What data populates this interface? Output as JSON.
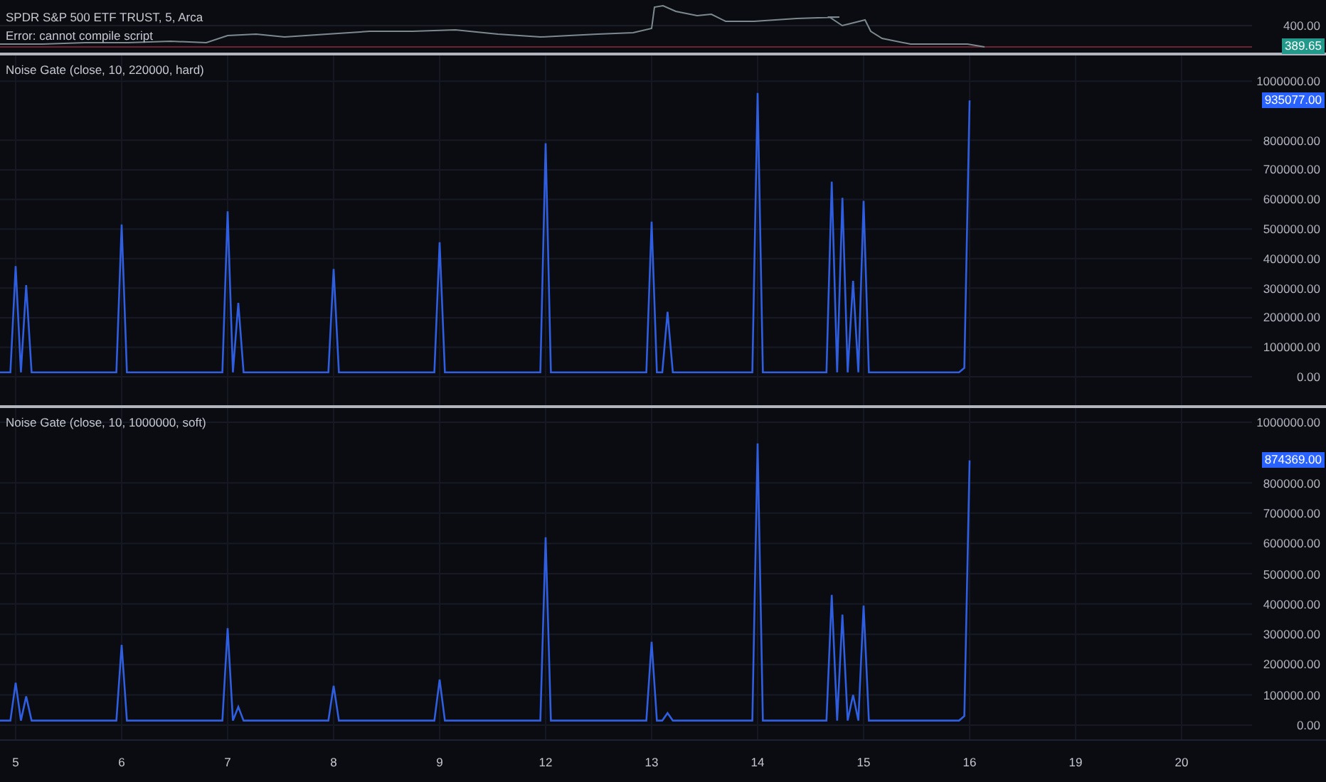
{
  "main_pane": {
    "symbol_title": "SPDR S&P 500 ETF TRUST, 5, Arca",
    "error_message": "Error: cannot compile script",
    "price_scale": [
      "400.00"
    ],
    "last_price": "389.65"
  },
  "panes": [
    {
      "last_value": "935077.00",
      "chart_data": {
        "type": "line",
        "title": "Noise Gate (close, 10, 220000, hard)",
        "categories": [
          null,
          null,
          null,
          null,
          null,
          null,
          null,
          null,
          null,
          null,
          null,
          null,
          null,
          null,
          null,
          null,
          null,
          null,
          null,
          null,
          null,
          null,
          null,
          null,
          null,
          null,
          null,
          null,
          null,
          null,
          null,
          null,
          null,
          null,
          null,
          null,
          null,
          null,
          null,
          null,
          null,
          null,
          null,
          null,
          null,
          null,
          null,
          null,
          null,
          null,
          null,
          null,
          null,
          null,
          null,
          null,
          null,
          null,
          null,
          null,
          null,
          null,
          null,
          null,
          null,
          null,
          null,
          null,
          null,
          null,
          null,
          null,
          null,
          null,
          null,
          null,
          null,
          null,
          null,
          null,
          null,
          null,
          null,
          null,
          null,
          null,
          null,
          null,
          null,
          null,
          null,
          null,
          null,
          null,
          null,
          null,
          null,
          null,
          null,
          null,
          null,
          null,
          null,
          null,
          null,
          null,
          null,
          null,
          null,
          null,
          null,
          null,
          null,
          null,
          null,
          null,
          null,
          null,
          null,
          null,
          null,
          null,
          null,
          null,
          null,
          null,
          null,
          null,
          null,
          null,
          null,
          null,
          null,
          null,
          null,
          null,
          null,
          null,
          null,
          null,
          null,
          null,
          null,
          null,
          null,
          null,
          null,
          null,
          null,
          null,
          null,
          null,
          null,
          null,
          null,
          null,
          null,
          null,
          null,
          null,
          null,
          null,
          null,
          null,
          null,
          null,
          null,
          null,
          null,
          null,
          null,
          null,
          null,
          null,
          null,
          null,
          null,
          null,
          null,
          null,
          null,
          null,
          null,
          null
        ],
        "series": [
          {
            "color": "#2f5fe0",
            "values": [
              15000,
              15000,
              15000,
              375000,
              15000,
              310000,
              15000,
              15000,
              15000,
              15000,
              15000,
              15000,
              15000,
              15000,
              15000,
              15000,
              15000,
              15000,
              15000,
              15000,
              15000,
              15000,
              15000,
              515000,
              15000,
              15000,
              15000,
              15000,
              15000,
              15000,
              15000,
              15000,
              15000,
              15000,
              15000,
              15000,
              15000,
              15000,
              15000,
              15000,
              15000,
              15000,
              15000,
              560000,
              15000,
              250000,
              15000,
              15000,
              15000,
              15000,
              15000,
              15000,
              15000,
              15000,
              15000,
              15000,
              15000,
              15000,
              15000,
              15000,
              15000,
              15000,
              15000,
              365000,
              15000,
              15000,
              15000,
              15000,
              15000,
              15000,
              15000,
              15000,
              15000,
              15000,
              15000,
              15000,
              15000,
              15000,
              15000,
              15000,
              15000,
              15000,
              15000,
              455000,
              15000,
              15000,
              15000,
              15000,
              15000,
              15000,
              15000,
              15000,
              15000,
              15000,
              15000,
              15000,
              15000,
              15000,
              15000,
              15000,
              15000,
              15000,
              15000,
              790000,
              15000,
              15000,
              15000,
              15000,
              15000,
              15000,
              15000,
              15000,
              15000,
              15000,
              15000,
              15000,
              15000,
              15000,
              15000,
              15000,
              15000,
              15000,
              15000,
              525000,
              15000,
              15000,
              220000,
              15000,
              15000,
              15000,
              15000,
              15000,
              15000,
              15000,
              15000,
              15000,
              15000,
              15000,
              15000,
              15000,
              15000,
              15000,
              15000,
              960000,
              15000,
              15000,
              15000,
              15000,
              15000,
              15000,
              15000,
              15000,
              15000,
              15000,
              15000,
              15000,
              15000,
              660000,
              15000,
              605000,
              15000,
              325000,
              15000,
              595000,
              15000,
              15000,
              15000,
              15000,
              15000,
              15000,
              15000,
              15000,
              15000,
              15000,
              15000,
              15000,
              15000,
              15000,
              15000,
              15000,
              15000,
              15000,
              30000,
              935000
            ]
          }
        ],
        "grid": true,
        "ylim": [
          -96000,
          1087000
        ],
        "yticks": [
          {
            "value": 0,
            "label": "0.00"
          },
          {
            "value": 100000,
            "label": "100000.00"
          },
          {
            "value": 200000,
            "label": "200000.00"
          },
          {
            "value": 300000,
            "label": "300000.00"
          },
          {
            "value": 400000,
            "label": "400000.00"
          },
          {
            "value": 500000,
            "label": "500000.00"
          },
          {
            "value": 600000,
            "label": "600000.00"
          },
          {
            "value": 700000,
            "label": "700000.00"
          },
          {
            "value": 800000,
            "label": "800000.00"
          },
          {
            "value": 1000000,
            "label": "1000000.00"
          }
        ]
      }
    },
    {
      "last_value": "874369.00",
      "chart_data": {
        "type": "line",
        "title": "Noise Gate (close, 10, 1000000, soft)",
        "categories": [
          null,
          null,
          null,
          null,
          null,
          null,
          null,
          null,
          null,
          null,
          null,
          null,
          null,
          null,
          null,
          null,
          null,
          null,
          null,
          null,
          null,
          null,
          null,
          null,
          null,
          null,
          null,
          null,
          null,
          null,
          null,
          null,
          null,
          null,
          null,
          null,
          null,
          null,
          null,
          null,
          null,
          null,
          null,
          null,
          null,
          null,
          null,
          null,
          null,
          null,
          null,
          null,
          null,
          null,
          null,
          null,
          null,
          null,
          null,
          null,
          null,
          null,
          null,
          null,
          null,
          null,
          null,
          null,
          null,
          null,
          null,
          null,
          null,
          null,
          null,
          null,
          null,
          null,
          null,
          null,
          null,
          null,
          null,
          null,
          null,
          null,
          null,
          null,
          null,
          null,
          null,
          null,
          null,
          null,
          null,
          null,
          null,
          null,
          null,
          null,
          null,
          null,
          null,
          null,
          null,
          null,
          null,
          null,
          null,
          null,
          null,
          null,
          null,
          null,
          null,
          null,
          null,
          null,
          null,
          null,
          null,
          null,
          null,
          null,
          null,
          null,
          null,
          null,
          null,
          null,
          null,
          null,
          null,
          null,
          null,
          null,
          null,
          null,
          null,
          null,
          null,
          null,
          null,
          null,
          null,
          null,
          null,
          null,
          null,
          null,
          null,
          null,
          null,
          null,
          null,
          null,
          null,
          null,
          null,
          null,
          null,
          null,
          null,
          null,
          null,
          null,
          null,
          null,
          null,
          null,
          null,
          null,
          null,
          null,
          null,
          null,
          null,
          null,
          null,
          null,
          null,
          null,
          null,
          null
        ],
        "series": [
          {
            "color": "#2f5fe0",
            "values": [
              15000,
              15000,
              15000,
              140000,
              15000,
              95000,
              15000,
              15000,
              15000,
              15000,
              15000,
              15000,
              15000,
              15000,
              15000,
              15000,
              15000,
              15000,
              15000,
              15000,
              15000,
              15000,
              15000,
              265000,
              15000,
              15000,
              15000,
              15000,
              15000,
              15000,
              15000,
              15000,
              15000,
              15000,
              15000,
              15000,
              15000,
              15000,
              15000,
              15000,
              15000,
              15000,
              15000,
              320000,
              15000,
              60000,
              15000,
              15000,
              15000,
              15000,
              15000,
              15000,
              15000,
              15000,
              15000,
              15000,
              15000,
              15000,
              15000,
              15000,
              15000,
              15000,
              15000,
              130000,
              15000,
              15000,
              15000,
              15000,
              15000,
              15000,
              15000,
              15000,
              15000,
              15000,
              15000,
              15000,
              15000,
              15000,
              15000,
              15000,
              15000,
              15000,
              15000,
              150000,
              15000,
              15000,
              15000,
              15000,
              15000,
              15000,
              15000,
              15000,
              15000,
              15000,
              15000,
              15000,
              15000,
              15000,
              15000,
              15000,
              15000,
              15000,
              15000,
              620000,
              15000,
              15000,
              15000,
              15000,
              15000,
              15000,
              15000,
              15000,
              15000,
              15000,
              15000,
              15000,
              15000,
              15000,
              15000,
              15000,
              15000,
              15000,
              15000,
              275000,
              15000,
              15000,
              40000,
              15000,
              15000,
              15000,
              15000,
              15000,
              15000,
              15000,
              15000,
              15000,
              15000,
              15000,
              15000,
              15000,
              15000,
              15000,
              15000,
              930000,
              15000,
              15000,
              15000,
              15000,
              15000,
              15000,
              15000,
              15000,
              15000,
              15000,
              15000,
              15000,
              15000,
              430000,
              15000,
              365000,
              15000,
              100000,
              15000,
              395000,
              15000,
              15000,
              15000,
              15000,
              15000,
              15000,
              15000,
              15000,
              15000,
              15000,
              15000,
              15000,
              15000,
              15000,
              15000,
              15000,
              15000,
              15000,
              30000,
              874000
            ]
          }
        ],
        "grid": true,
        "ylim": [
          -47000,
          1047000
        ],
        "yticks": [
          {
            "value": 0,
            "label": "0.00"
          },
          {
            "value": 100000,
            "label": "100000.00"
          },
          {
            "value": 200000,
            "label": "200000.00"
          },
          {
            "value": 300000,
            "label": "300000.00"
          },
          {
            "value": 400000,
            "label": "400000.00"
          },
          {
            "value": 500000,
            "label": "500000.00"
          },
          {
            "value": 600000,
            "label": "600000.00"
          },
          {
            "value": 700000,
            "label": "700000.00"
          },
          {
            "value": 800000,
            "label": "800000.00"
          },
          {
            "value": 1000000,
            "label": "1000000.00"
          }
        ]
      }
    }
  ],
  "time_axis": {
    "labels": [
      "5",
      "6",
      "7",
      "8",
      "9",
      "12",
      "13",
      "14",
      "15",
      "16",
      "19",
      "20"
    ]
  }
}
